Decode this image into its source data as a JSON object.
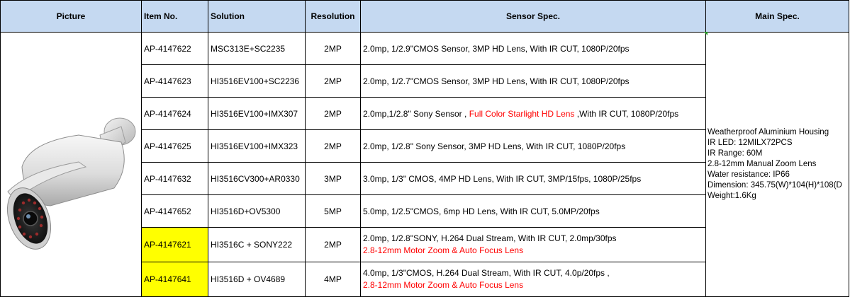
{
  "headers": {
    "picture": "Picture",
    "item_no": "Item No.",
    "solution": "Solution",
    "resolution": "Resolution",
    "sensor_spec": "Sensor Spec.",
    "main_spec": "Main Spec."
  },
  "rows": [
    {
      "item": "AP-4147622",
      "solution": "MSC313E+SC2235",
      "resolution": "2MP",
      "sensor_a": "2.0mp, 1/2.9\"CMOS Sensor, 3MP HD Lens, With IR CUT, 1080P/20fps"
    },
    {
      "item": "AP-4147623",
      "solution": "HI3516EV100+SC2236",
      "resolution": "2MP",
      "sensor_a": "2.0mp, 1/2.7\"CMOS Sensor, 3MP HD Lens, With IR CUT, 1080P/20fps"
    },
    {
      "item": "AP-4147624",
      "solution": "HI3516EV100+IMX307",
      "resolution": "2MP",
      "sensor_a": "2.0mp,1/2.8\" Sony Sensor , ",
      "sensor_red": "Full Color Starlight HD Lens",
      "sensor_b": " ,With IR CUT, 1080P/20fps"
    },
    {
      "item": "AP-4147625",
      "solution": "HI3516EV100+IMX323",
      "resolution": "2MP",
      "sensor_a": "2.0mp, 1/2.8\" Sony Sensor, 3MP HD Lens, With IR CUT, 1080P/20fps"
    },
    {
      "item": "AP-4147632",
      "solution": "HI3516CV300+AR0330",
      "resolution": "3MP",
      "sensor_a": "3.0mp, 1/3\" CMOS, 4MP  HD Lens, With IR CUT, 3MP/15fps, 1080P/25fps"
    },
    {
      "item": "AP-4147652",
      "solution": "HI3516D+OV5300",
      "resolution": "5MP",
      "sensor_a": "5.0mp, 1/2.5\"CMOS, 6mp HD Lens, With IR CUT,   5.0MP/20fps"
    },
    {
      "item": "AP-4147621",
      "solution": "HI3516C + SONY222",
      "resolution": "2MP",
      "sensor_line1": "2.0mp, 1/2.8\"SONY, H.264 Dual Stream, With  IR CUT, 2.0mp/30fps",
      "sensor_line2": "2.8-12mm Motor Zoom & Auto Focus Lens"
    },
    {
      "item": "AP-4147641",
      "solution": "HI3516D + OV4689",
      "resolution": "4MP",
      "sensor_line1": "4.0mp, 1/3\"CMOS, H.264 Dual Stream, With  IR CUT, 4.0p/20fps ,",
      "sensor_line2": "2.8-12mm Motor Zoom & Auto Focus Lens"
    }
  ],
  "main_spec": [
    "Weatherproof Aluminium Housing",
    "IR LED: 12MILX72PCS",
    "IR Range: 60M",
    "2.8-12mm Manual Zoom Lens",
    "Water resistance: IP66",
    "Dimension: 345.75(W)*104(H)*108(D",
    "Weight:1.6Kg"
  ],
  "colors": {
    "header_bg": "#c5d9f1",
    "highlight": "#ffff00",
    "red_text": "#ff0000",
    "comment_marker": "#1f9a1f"
  },
  "picture": {
    "icon": "bullet-camera-image"
  }
}
